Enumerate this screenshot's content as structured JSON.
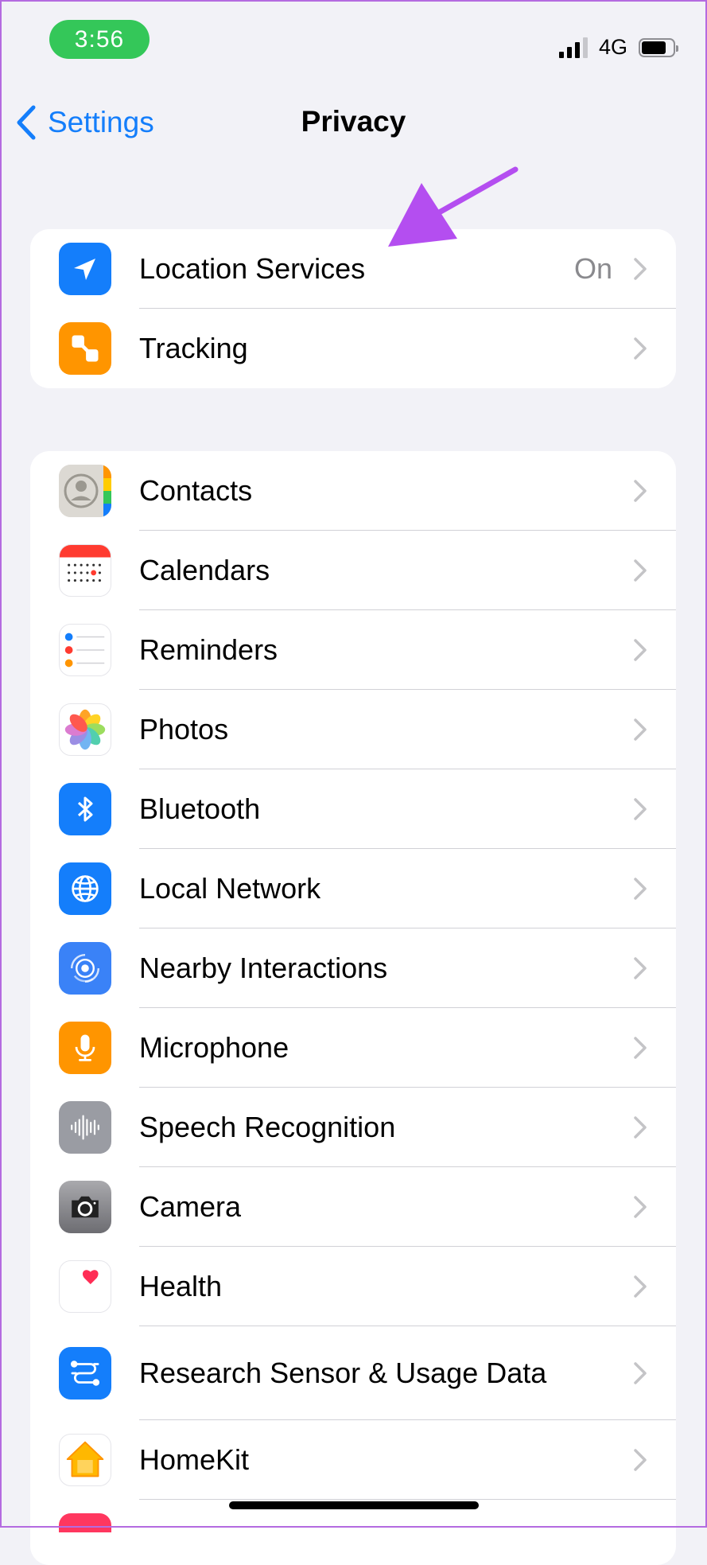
{
  "status_bar": {
    "time": "3:56",
    "network": "4G"
  },
  "nav": {
    "back_label": "Settings",
    "title": "Privacy"
  },
  "group1": [
    {
      "label": "Location Services",
      "value": "On",
      "icon": "location-arrow-icon",
      "color": "#147efb"
    },
    {
      "label": "Tracking",
      "value": "",
      "icon": "tracking-icon",
      "color": "#ff9500"
    }
  ],
  "group2": [
    {
      "label": "Contacts",
      "icon": "contacts-icon"
    },
    {
      "label": "Calendars",
      "icon": "calendar-icon"
    },
    {
      "label": "Reminders",
      "icon": "reminders-icon"
    },
    {
      "label": "Photos",
      "icon": "photos-icon"
    },
    {
      "label": "Bluetooth",
      "icon": "bluetooth-icon"
    },
    {
      "label": "Local Network",
      "icon": "globe-icon"
    },
    {
      "label": "Nearby Interactions",
      "icon": "nearby-icon"
    },
    {
      "label": "Microphone",
      "icon": "microphone-icon"
    },
    {
      "label": "Speech Recognition",
      "icon": "waveform-icon"
    },
    {
      "label": "Camera",
      "icon": "camera-icon"
    },
    {
      "label": "Health",
      "icon": "heart-icon"
    },
    {
      "label": "Research Sensor & Usage Data",
      "icon": "research-icon"
    },
    {
      "label": "HomeKit",
      "icon": "home-icon"
    }
  ],
  "colors": {
    "accent": "#147efb",
    "arrow_annotation": "#b44ef0",
    "time_pill": "#34c759"
  }
}
